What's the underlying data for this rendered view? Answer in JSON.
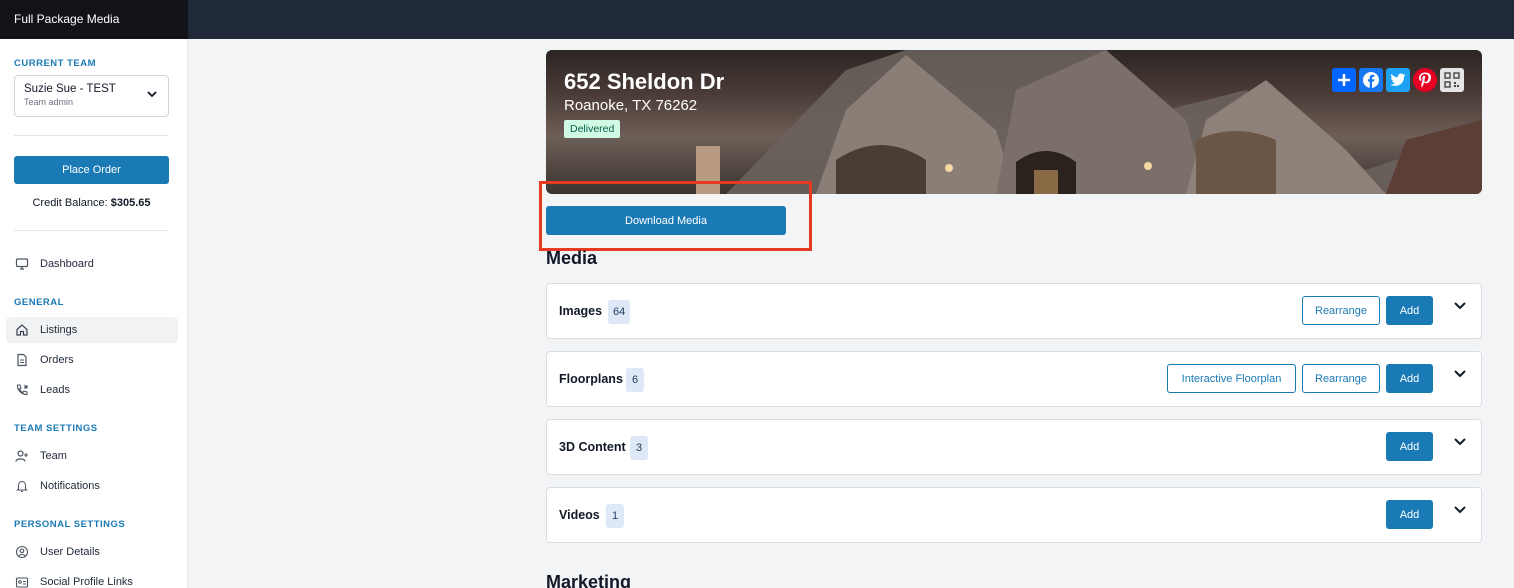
{
  "app": {
    "brand": "Full Package Media"
  },
  "sidebar": {
    "current_team_label": "CURRENT TEAM",
    "team_name": "Suzie Sue - TEST",
    "team_role": "Team admin",
    "place_order_label": "Place Order",
    "credit_label": "Credit Balance:",
    "credit_value": "$305.65",
    "dashboard": "Dashboard",
    "general_label": "GENERAL",
    "listings": "Listings",
    "orders": "Orders",
    "leads": "Leads",
    "team_settings_label": "TEAM SETTINGS",
    "team": "Team",
    "notifications": "Notifications",
    "personal_settings_label": "PERSONAL SETTINGS",
    "user_details": "User Details",
    "social_profile_links": "Social Profile Links"
  },
  "listing": {
    "address": "652 Sheldon Dr",
    "city_state_zip": "Roanoke, TX 76262",
    "status": "Delivered",
    "download_label": "Download Media"
  },
  "media": {
    "heading": "Media",
    "images": {
      "title": "Images",
      "count": "64",
      "rearrange": "Rearrange",
      "add": "Add"
    },
    "floorplans": {
      "title": "Floorplans",
      "count": "6",
      "interactive": "Interactive Floorplan",
      "rearrange": "Rearrange",
      "add": "Add"
    },
    "content3d": {
      "title": "3D Content",
      "count": "3",
      "add": "Add"
    },
    "videos": {
      "title": "Videos",
      "count": "1",
      "add": "Add"
    }
  },
  "marketing": {
    "heading": "Marketing"
  },
  "colors": {
    "accent": "#1a7ab5",
    "highlight": "#e63a22",
    "badge_green": "#d1fae5"
  },
  "icons": [
    "monitor-icon",
    "home-icon",
    "document-icon",
    "phone-icon",
    "user-plus-icon",
    "bell-icon",
    "user-circle-icon",
    "id-card-icon",
    "share-plus-icon",
    "facebook-icon",
    "twitter-icon",
    "pinterest-icon",
    "qr-code-icon",
    "chevron-down-icon"
  ]
}
